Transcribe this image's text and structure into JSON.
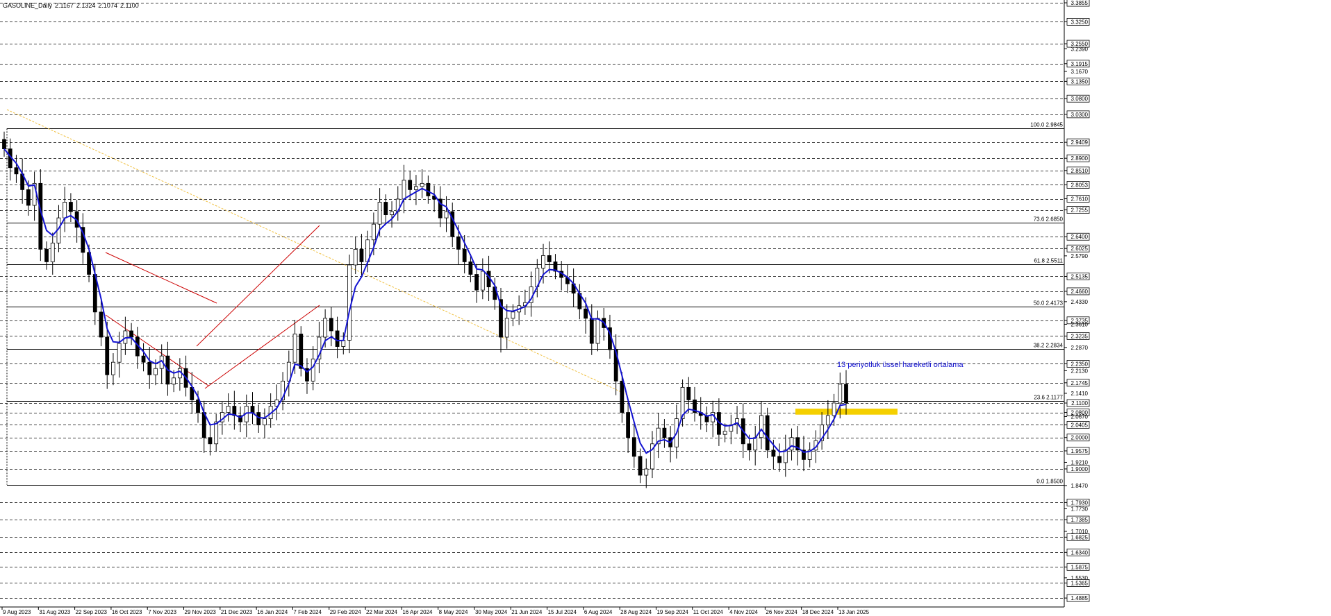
{
  "header": {
    "symbol": "GASOLINE_Daily",
    "open": "2.1167",
    "high": "2.1324",
    "low": "2.1074",
    "close": "2.1100"
  },
  "chart_data": {
    "type": "candlestick",
    "ylim": [
      1.46,
      3.39
    ],
    "price_scale_labels": [
      "3.3855",
      "3.3250",
      "3.2550",
      "3.2390",
      "3.1915",
      "3.1670",
      "3.1350",
      "3.0800",
      "3.0300",
      "2.9409",
      "2.8900",
      "2.8510",
      "2.8053",
      "2.7610",
      "2.7255",
      "2.6400",
      "2.6025",
      "2.5790",
      "2.5135",
      "2.4660",
      "2.4330",
      "2.3735",
      "2.3610",
      "2.3235",
      "2.2870",
      "2.2350",
      "2.2130",
      "2.1745",
      "2.1410",
      "2.1100",
      "2.0800",
      "2.0670",
      "2.0405",
      "2.0000",
      "1.9575",
      "1.9210",
      "1.9000",
      "1.8470",
      "1.7930",
      "1.7730",
      "1.7385",
      "1.7010",
      "1.6825",
      "1.6340",
      "1.5875",
      "1.5530",
      "1.5365",
      "1.4885"
    ],
    "price_scale_boxed": [
      "3.3855",
      "3.3250",
      "3.2550",
      "3.1915",
      "3.1350",
      "3.0800",
      "3.0300",
      "2.9409",
      "2.8900",
      "2.8510",
      "2.8053",
      "2.7610",
      "2.7255",
      "2.6400",
      "2.6025",
      "2.5135",
      "2.4660",
      "2.3735",
      "2.3235",
      "2.2350",
      "2.1745",
      "2.1100",
      "2.0800",
      "2.0405",
      "2.0000",
      "1.9575",
      "1.9000",
      "1.7930",
      "1.7385",
      "1.6825",
      "1.6340",
      "1.5875",
      "1.5365",
      "1.4885"
    ],
    "x_tick_labels": [
      "9 Aug 2023",
      "31 Aug 2023",
      "22 Sep 2023",
      "16 Oct 2023",
      "7 Nov 2023",
      "29 Nov 2023",
      "21 Dec 2023",
      "16 Jan 2024",
      "7 Feb 2024",
      "29 Feb 2024",
      "22 Mar 2024",
      "16 Apr 2024",
      "8 May 2024",
      "30 May 2024",
      "21 Jun 2024",
      "15 Jul 2024",
      "6 Aug 2024",
      "28 Aug 2024",
      "19 Sep 2024",
      "11 Oct 2024",
      "4 Nov 2024",
      "26 Nov 2024",
      "18 Dec 2024",
      "13 Jan 2025"
    ],
    "fibonacci": [
      {
        "label": "100.0 2.9845",
        "value": 2.9845
      },
      {
        "label": "73.6 2.6850",
        "value": 2.685
      },
      {
        "label": "61.8 2.5511",
        "value": 2.5511
      },
      {
        "label": "50.0 2.4173",
        "value": 2.4173
      },
      {
        "label": "38.2 2.2834",
        "value": 2.2834
      },
      {
        "label": "23.6 2.1177",
        "value": 2.1177
      },
      {
        "label": "0.0 1.8500",
        "value": 1.85
      }
    ],
    "close_series": [
      2.92,
      2.86,
      2.84,
      2.79,
      2.74,
      2.81,
      2.6,
      2.56,
      2.62,
      2.7,
      2.75,
      2.72,
      2.67,
      2.59,
      2.52,
      2.4,
      2.32,
      2.2,
      2.24,
      2.3,
      2.34,
      2.32,
      2.26,
      2.24,
      2.2,
      2.22,
      2.26,
      2.17,
      2.19,
      2.22,
      2.16,
      2.12,
      2.08,
      2.0,
      1.98,
      2.05,
      2.08,
      2.1,
      2.07,
      2.05,
      2.1,
      2.08,
      2.04,
      2.06,
      2.1,
      2.12,
      2.18,
      2.24,
      2.33,
      2.22,
      2.18,
      2.25,
      2.32,
      2.38,
      2.34,
      2.29,
      2.31,
      2.55,
      2.6,
      2.56,
      2.63,
      2.68,
      2.75,
      2.71,
      2.72,
      2.76,
      2.82,
      2.79,
      2.8,
      2.81,
      2.77,
      2.76,
      2.7,
      2.72,
      2.64,
      2.6,
      2.56,
      2.52,
      2.47,
      2.53,
      2.48,
      2.44,
      2.32,
      2.38,
      2.4,
      2.42,
      2.43,
      2.48,
      2.54,
      2.58,
      2.56,
      2.53,
      2.51,
      2.49,
      2.46,
      2.41,
      2.38,
      2.3,
      2.38,
      2.35,
      2.28,
      2.18,
      2.08,
      2.0,
      1.94,
      1.88,
      1.9,
      1.98,
      2.03,
      2.0,
      1.97,
      2.06,
      2.16,
      2.12,
      2.08,
      2.07,
      2.05,
      2.08,
      2.01,
      2.02,
      2.04,
      2.06,
      1.98,
      1.96,
      2.0,
      2.07,
      1.96,
      1.94,
      1.92,
      1.96,
      2.0,
      1.96,
      1.93,
      1.96,
      1.99,
      2.04,
      2.07,
      2.11,
      2.17,
      2.11
    ],
    "ema_label": "13 periyotluk üssel hareketli ortalama",
    "highlight_zone": [
      2.073,
      2.092
    ],
    "colors": {
      "ema": "#1414d2",
      "channel": "#cc0000",
      "trend": "#f0c040",
      "zone": "#f5d000",
      "ema_text": "#1414d2"
    }
  }
}
